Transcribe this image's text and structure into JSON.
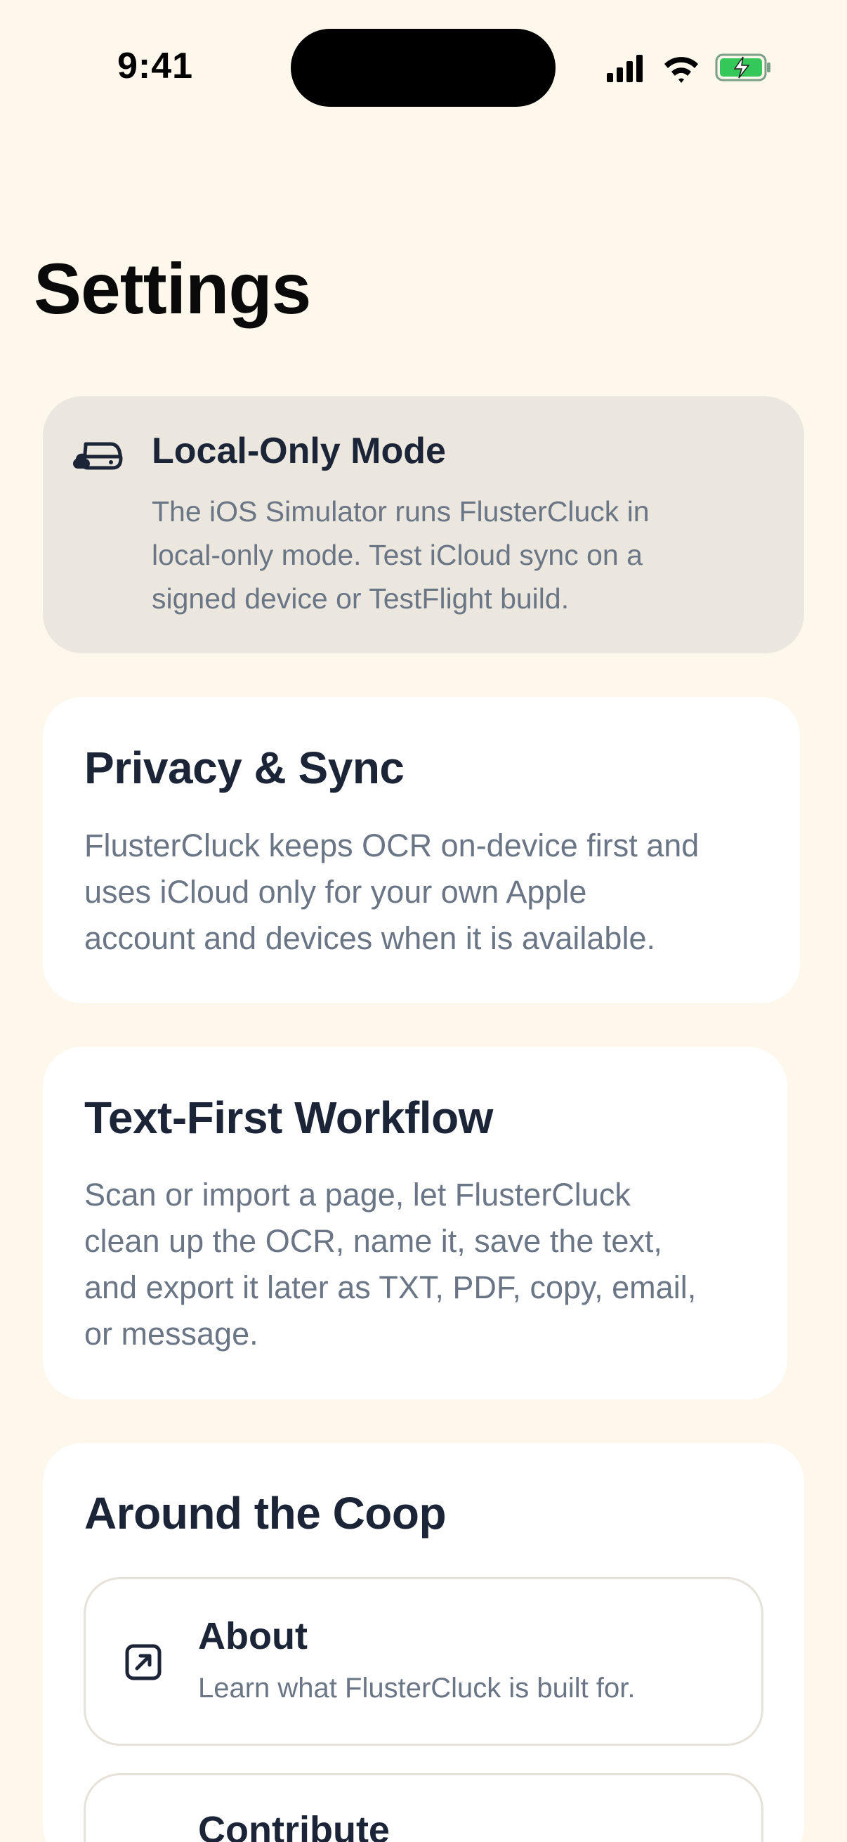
{
  "status_bar": {
    "time": "9:41",
    "icons": [
      "cellular-signal-icon",
      "wifi-icon",
      "battery-charging-icon"
    ],
    "battery_color": "#34c759"
  },
  "page": {
    "title": "Settings"
  },
  "notice": {
    "icon": "cloud-off-icon",
    "title": "Local-Only Mode",
    "lines": [
      "The iOS Simulator runs FlusterCluck in",
      "local-only mode. Test iCloud sync on a",
      "signed device or TestFlight build."
    ]
  },
  "privacy": {
    "title": "Privacy & Sync",
    "lines": [
      "FlusterCluck keeps OCR on-device first and",
      "uses iCloud only for your own Apple",
      "account and devices when it is available."
    ]
  },
  "workflow": {
    "title": "Text-First Workflow",
    "lines": [
      "Scan or import a page, let FlusterCluck",
      "clean up the OCR, name it, save the text,",
      "and export it later as TXT, PDF, copy, email,",
      "or message."
    ]
  },
  "coop": {
    "title": "Around the Coop",
    "items": [
      {
        "icon": "external-link-icon",
        "title": "About",
        "subtitle": "Learn what FlusterCluck is built for."
      },
      {
        "title": "Contribute"
      }
    ]
  },
  "colors": {
    "background": "#fdf7ec",
    "card": "#ffffff",
    "notice_card": "#ebe7de",
    "heading": "#1b2537",
    "body_text": "#6a7586"
  }
}
